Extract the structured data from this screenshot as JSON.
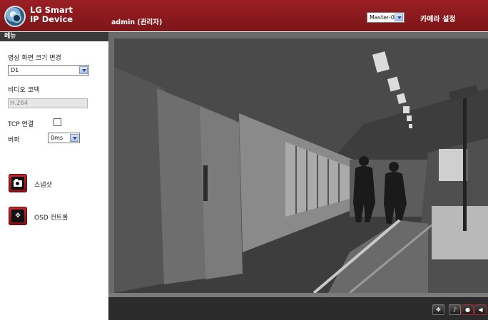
{
  "header": {
    "logo_line1": "LG Smart",
    "logo_line2": "IP Device",
    "user": "admin (관리자)",
    "stream_select": "Master-0",
    "camera_settings": "카메라 설정"
  },
  "sidebar": {
    "menu_title": "메뉴",
    "resolution_label": "영상 화면 크기 변경",
    "resolution_value": "D1",
    "codec_label": "비디오 코덱",
    "codec_value": "H.264",
    "tcp_label": "TCP 연결",
    "tcp_checked": false,
    "buffer_label": "버퍼",
    "buffer_value": "0ms",
    "snapshot_label": "스냅샷",
    "osd_label": "OSD 컨트롤"
  },
  "controls": {
    "icons": [
      "move-icon",
      "speaker-mic-icon",
      "microphone-icon",
      "volume-icon"
    ]
  },
  "colors": {
    "header": "#8c1b20",
    "accent_red": "#c42a31",
    "frame": "#6b6b6b"
  }
}
